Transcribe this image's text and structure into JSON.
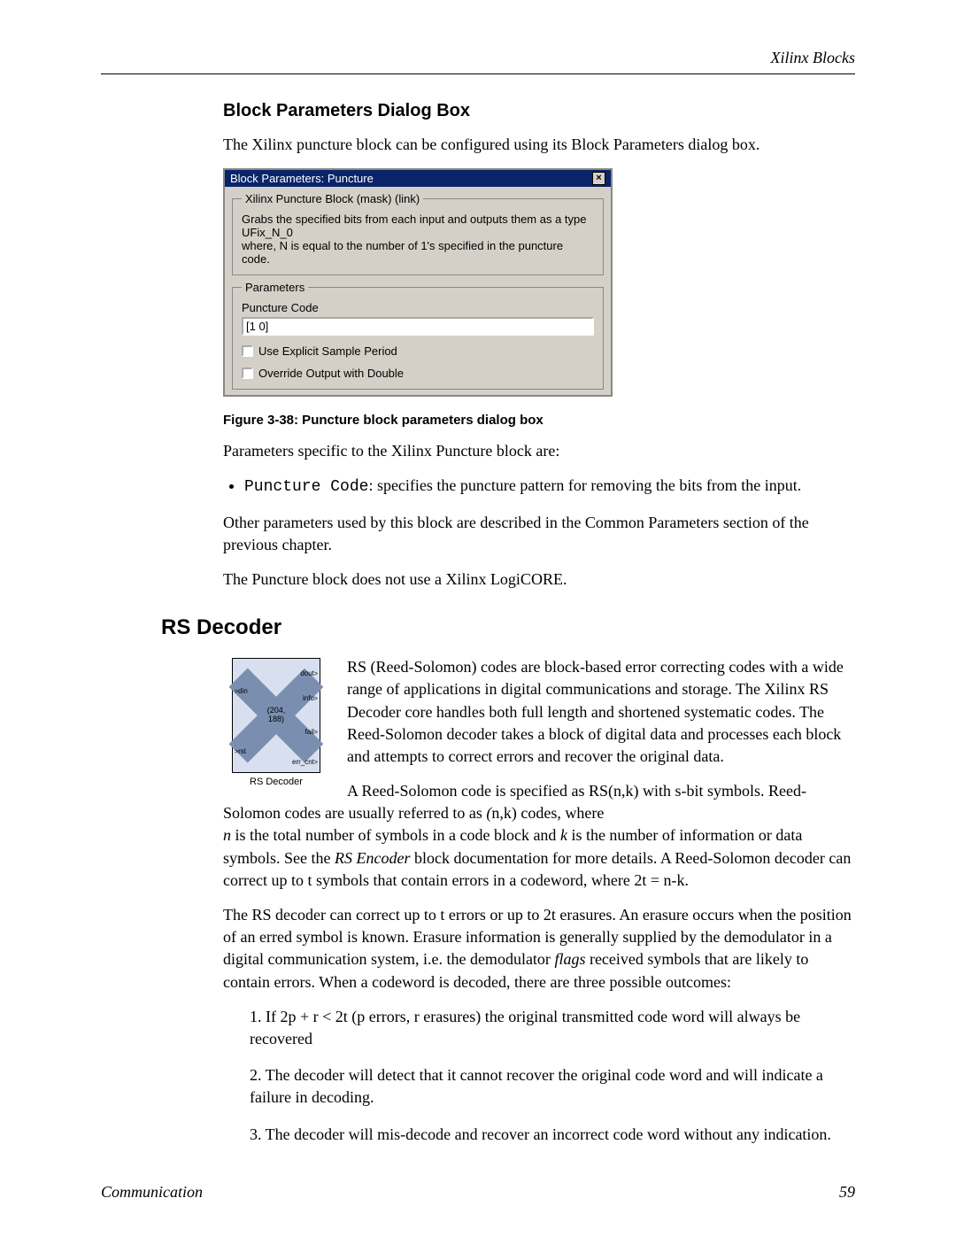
{
  "header_right": "Xilinx Blocks",
  "section1": {
    "title": "Block Parameters Dialog Box",
    "intro": "The Xilinx puncture block can be configured using its Block Parameters dialog box."
  },
  "dialog": {
    "title": "Block Parameters: Puncture",
    "group1_legend": "Xilinx Puncture Block (mask) (link)",
    "group1_text_a": "Grabs the specified bits from each input and outputs them as a type UFix_N_0",
    "group1_text_b": "where, N is equal to the number of 1's specified in the puncture code.",
    "group2_legend": "Parameters",
    "pcode_label": "Puncture Code",
    "pcode_value": "[1 0]",
    "chk1": "Use Explicit Sample Period",
    "chk2": "Override Output with Double"
  },
  "figure_caption": "Figure 3-38:   Puncture block parameters dialog box",
  "params_intro": "Parameters specific to the Xilinx Puncture block are:",
  "bullet_code": "Puncture Code",
  "bullet_rest": ": specifies the puncture pattern for removing the bits from the input.",
  "other_params": "Other parameters used by this block are described in the Common Parameters section of the previous chapter.",
  "no_logicore": "The Puncture block does not use a Xilinx LogiCORE.",
  "rs": {
    "heading": "RS Decoder",
    "icon_label": "RS Decoder",
    "center1": "(204,",
    "center2": "188)",
    "pins": {
      "din": "din",
      "rst": "rst",
      "dout": "dout",
      "info": "info",
      "fail": "fail",
      "err_cnt": "err_cnt"
    },
    "para1": "RS (Reed-Solomon) codes are block-based error correcting codes with a wide range of applications in digital communications and storage. The Xilinx RS Decoder core handles both full length and shortened systematic codes. The Reed-Solomon decoder takes a block of digital data and processes each block and attempts to correct errors and recover the original data.",
    "para2_a": "A Reed-Solomon code is specified as RS(n,k) with s-bit symbols. Reed-Solomon codes are usually referred to as ",
    "para2_b": "(",
    "para2_c": "n,k) codes, where ",
    "para3_n": "n",
    "para3_a": " is the total number of symbols in a code block and ",
    "para3_k": "k",
    "para3_b": " is the number of information or data symbols. See the ",
    "para3_enc": "RS Encoder",
    "para3_c": " block documentation for more details. A Reed-Solomon decoder can correct up to t symbols that contain errors in a codeword, where 2t = n-k.",
    "para4_a": "The RS decoder can correct up to t errors or up to 2t erasures. An erasure occurs when the position of an erred symbol is known. Erasure information is generally supplied by the demodulator in a digital communication system, i.e. the demodulator ",
    "para4_flags": "flags",
    "para4_b": " received symbols that are likely to contain errors. When a codeword is decoded, there are three possible outcomes:",
    "out1": "1. If 2p + r < 2t (p errors, r erasures) the original transmitted code word will always be recovered",
    "out2": "2. The decoder will detect that it cannot recover the original code word and will indicate a failure in decoding.",
    "out3": "3. The decoder will mis-decode and recover an incorrect code word without any indication."
  },
  "footer_left": "Communication",
  "footer_right": "59"
}
